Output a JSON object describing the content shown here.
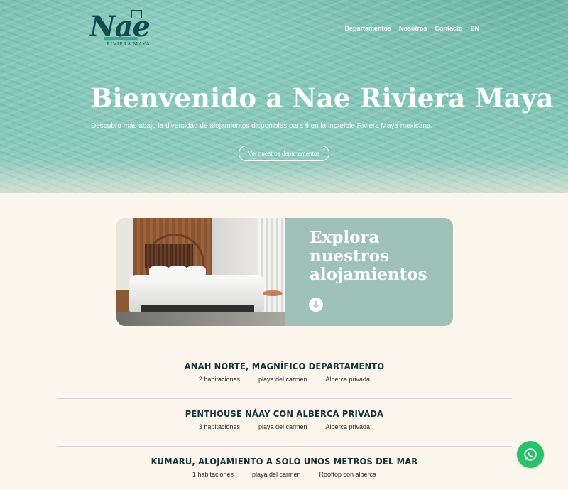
{
  "brand": {
    "logo_word": "Nae",
    "logo_sub": "RIVIERA MAYA"
  },
  "nav": {
    "items": [
      {
        "label": "Departamentos"
      },
      {
        "label": "Nosotros"
      },
      {
        "label": "Contacto"
      },
      {
        "label": "EN"
      }
    ],
    "active": "Contacto"
  },
  "hero": {
    "title": "Bienvenido a Nae Riviera Maya",
    "subtitle": "Descubre más abajo la diversidad de alojamientos disponibles para ti en la increíble Riviera Maya mexicana.",
    "button_label": "Ver nuestros departamentos"
  },
  "explore": {
    "title": "Explora nuestros alojamientos",
    "icon": "arrow-down-icon"
  },
  "listings": [
    {
      "title": "ANAH NORTE, MAGNÍFICO DEPARTAMENTO",
      "rooms": "2 habitaciones",
      "location": "playa del carmen",
      "feature": "Alberca privada"
    },
    {
      "title": "PENTHOUSE NÁAY CON ALBERCA PRIVADA",
      "rooms": "3 habitaciones",
      "location": "playa del carmen",
      "feature": "Alberca privada"
    },
    {
      "title": "KUMARU, ALOJAMIENTO A SOLO UNOS METROS DEL MAR",
      "rooms": "1 habitaciones",
      "location": "playa del carmen",
      "feature": "Rooftop con alberca"
    }
  ],
  "colors": {
    "accent": "#9ec2b7",
    "background": "#fdf6ec",
    "heading": "#13323a",
    "whatsapp": "#29c26a"
  },
  "whatsapp": {
    "icon": "whatsapp-icon"
  }
}
